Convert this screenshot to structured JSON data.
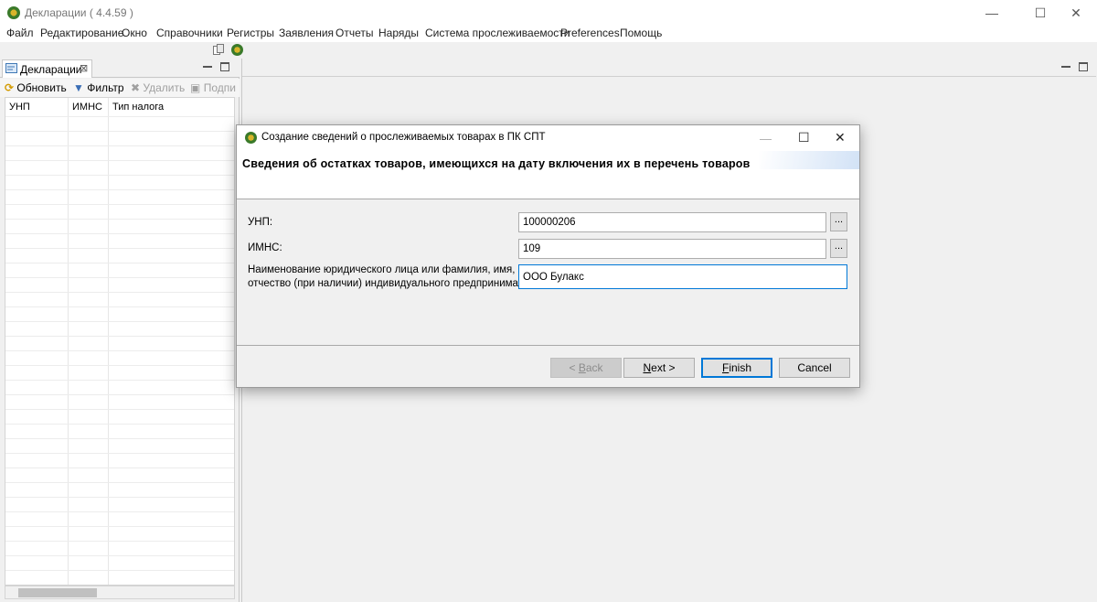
{
  "window": {
    "title": "Декларации ( 4.4.59 )",
    "min": "—",
    "max": "☐",
    "close": "✕"
  },
  "menu": [
    "Файл",
    "Редактирование",
    "Окно",
    "Справочники",
    "Регистры",
    "Заявления",
    "Отчеты",
    "Наряды",
    "Система прослеживаемости",
    "Preferences",
    "Помощь"
  ],
  "left_view": {
    "tab_label": "Декларации",
    "tab_close": "⊠",
    "actions": {
      "refresh": "Обновить",
      "filter": "Фильтр",
      "delete": "Удалить",
      "sign": "Подпи"
    },
    "columns": [
      "УНП",
      "ИМНС",
      "Тип налога"
    ]
  },
  "dialog": {
    "title": "Создание сведений о прослеживаемых товарах в ПК СПТ",
    "heading": "Сведения об остатках товаров, имеющихся на дату включения их в перечень товаров",
    "fields": {
      "unp_label": "УНП:",
      "unp_value": "100000206",
      "imns_label": "ИМНС:",
      "imns_value": "109",
      "name_label_1": "Наименование  юридического лица или фамилия, имя,",
      "name_label_2": "отчество (при наличии) индивидуального предпринимателя",
      "name_value": "ООО Булакс"
    },
    "ellipsis": "...",
    "buttons": {
      "back_prefix": "< ",
      "back_accel": "B",
      "back_rest": "ack",
      "next_accel": "N",
      "next_rest": "ext >",
      "finish_accel": "F",
      "finish_rest": "inish",
      "cancel": "Cancel"
    }
  }
}
